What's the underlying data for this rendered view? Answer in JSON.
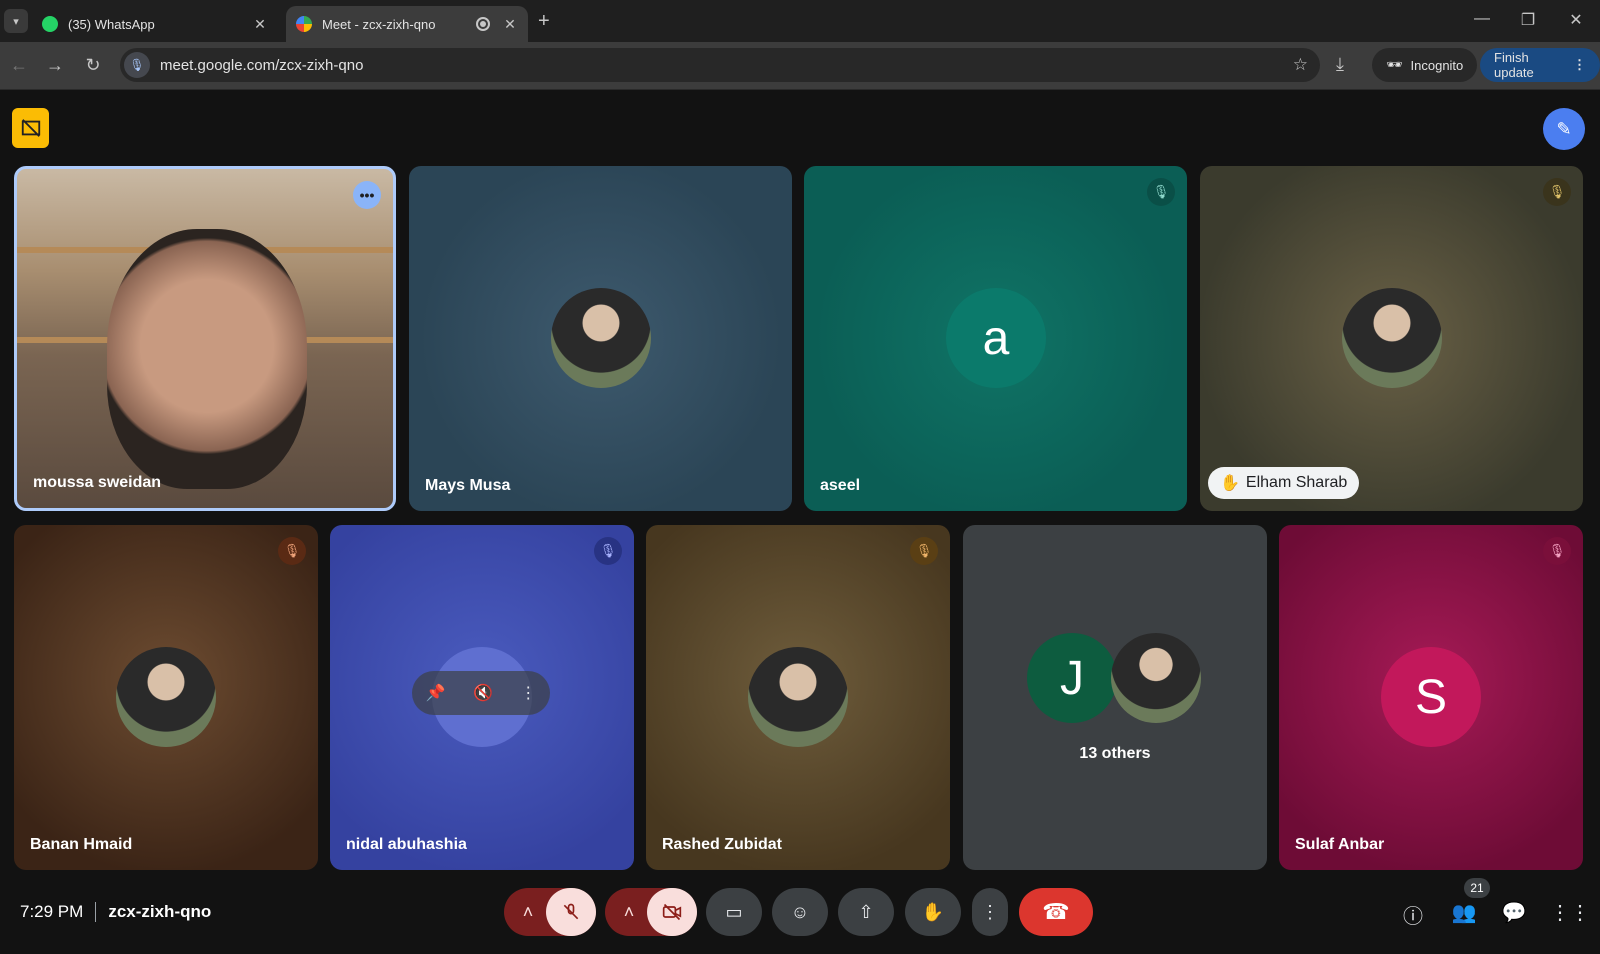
{
  "browser": {
    "tabs": [
      {
        "title": "(35) WhatsApp",
        "badge": "35",
        "active": false
      },
      {
        "title": "Meet - zcx-zixh-qno",
        "active": true
      }
    ],
    "new_tab": "+",
    "window": {
      "minimize": "—",
      "restore": "❐",
      "close": "✕"
    },
    "url": "meet.google.com/zcx-zixh-qno",
    "incognito_label": "Incognito",
    "finish_update_label": "Finish update"
  },
  "participants": [
    {
      "name": "moussa sweidan",
      "muted": false,
      "speaking": true
    },
    {
      "name": "Mays Musa",
      "muted": false
    },
    {
      "name": "aseel",
      "initial": "a",
      "avatar_color": "#0b7a6b",
      "muted": true
    },
    {
      "name": "Elham Sharab",
      "muted": true,
      "hand_raised": true
    },
    {
      "name": "Banan Hmaid",
      "muted": true
    },
    {
      "name": "nidal abuhashia",
      "muted": true
    },
    {
      "name": "Rashed Zubidat",
      "muted": true
    },
    {
      "name": "Sulaf Anbar",
      "initial": "S",
      "avatar_color": "#c2185b",
      "muted": true
    }
  ],
  "others_tile": {
    "initial": "J",
    "avatar_color": "#0d5c3f",
    "label": "13 others"
  },
  "meeting": {
    "time": "7:29 PM",
    "code": "zcx-zixh-qno",
    "participant_count": "21"
  },
  "colors": {
    "accent": "#8ab4f8",
    "end_call": "#dc362e",
    "hand_chip": "#f1f3f4"
  }
}
